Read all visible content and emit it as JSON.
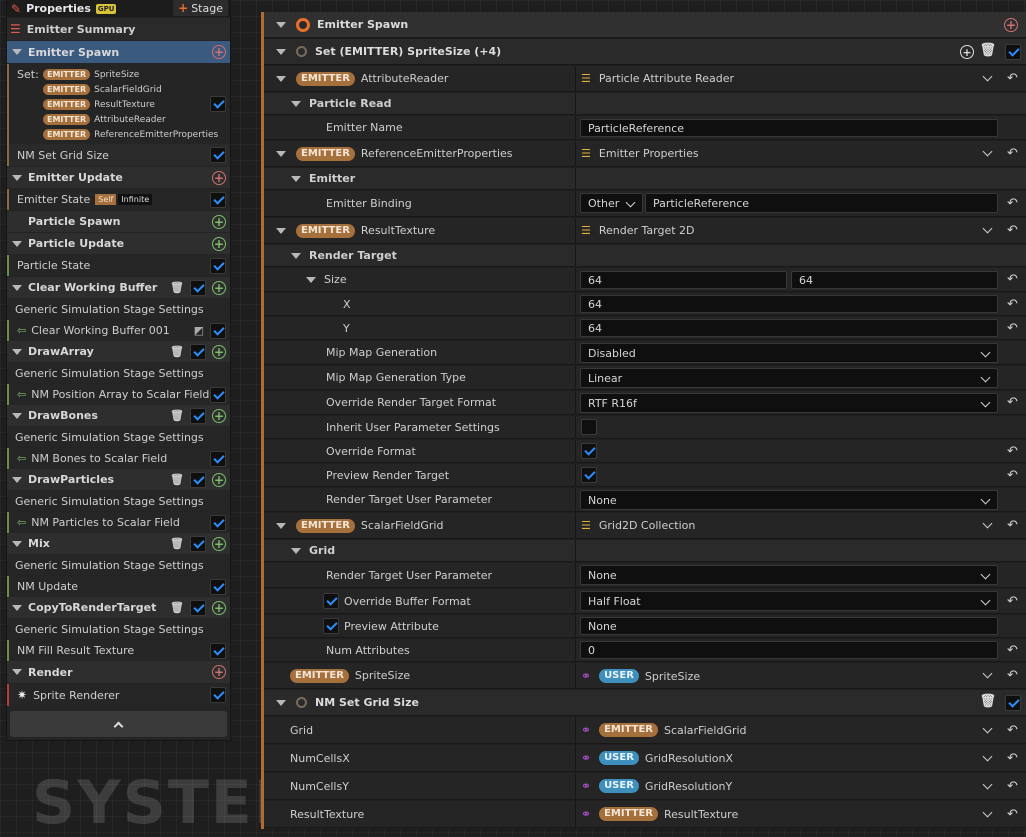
{
  "left": {
    "header": {
      "title": "Properties",
      "gpu_badge": "GPU",
      "stage_button": "Stage"
    },
    "emitter_summary": "Emitter Summary",
    "emitter_spawn": "Emitter Spawn",
    "set_label": "Set:",
    "emitter_badge": "EMITTER",
    "set_items": [
      "SpriteSize",
      "ScalarFieldGrid",
      "ResultTexture",
      "AttributeReader",
      "ReferenceEmitterProperties"
    ],
    "nm_set_grid_size": "NM Set Grid Size",
    "emitter_update": "Emitter Update",
    "emitter_state": "Emitter State",
    "self_badge": "Self",
    "infinite_badge": "Infinite",
    "particle_spawn": "Particle Spawn",
    "particle_update": "Particle Update",
    "particle_state": "Particle State",
    "generic_settings": "Generic Simulation Stage Settings",
    "stages": [
      {
        "title": "Clear Working Buffer",
        "item": "Clear Working Buffer 001"
      },
      {
        "title": "DrawArray",
        "item": "NM Position Array to Scalar Field"
      },
      {
        "title": "DrawBones",
        "item": "NM Bones to Scalar Field"
      },
      {
        "title": "DrawParticles",
        "item": "NM Particles to Scalar Field"
      },
      {
        "title": "Mix",
        "item": "NM Update"
      },
      {
        "title": "CopyToRenderTarget",
        "item": "NM Fill Result Texture"
      }
    ],
    "render": "Render",
    "sprite_renderer": "Sprite Renderer"
  },
  "watermark": "SYSTEM",
  "right": {
    "emitter_spawn": "Emitter Spawn",
    "set_header": "Set (EMITTER) SpriteSize (+4)",
    "emitter_badge": "EMITTER",
    "user_badge": "USER",
    "attribute_reader": {
      "name": "AttributeReader",
      "type": "Particle Attribute Reader",
      "group": "Particle Read",
      "emitter_name_label": "Emitter Name",
      "emitter_name_value": "ParticleReference"
    },
    "reference_props": {
      "name": "ReferenceEmitterProperties",
      "type": "Emitter Properties",
      "group": "Emitter",
      "binding_label": "Emitter Binding",
      "binding_mode": "Other",
      "binding_value": "ParticleReference"
    },
    "result_texture": {
      "name": "ResultTexture",
      "type": "Render Target 2D",
      "group": "Render Target",
      "size_label": "Size",
      "size_x": "64",
      "size_y": "64",
      "x_label": "X",
      "x_value": "64",
      "y_label": "Y",
      "y_value": "64",
      "mip_label": "Mip Map Generation",
      "mip_value": "Disabled",
      "mip_type_label": "Mip Map Generation Type",
      "mip_type_value": "Linear",
      "override_format_label": "Override Render Target Format",
      "override_format_value": "RTF R16f",
      "inherit_label": "Inherit User Parameter Settings",
      "override_label": "Override Format",
      "preview_label": "Preview Render Target",
      "rt_user_param_label": "Render Target User Parameter",
      "rt_user_param_value": "None"
    },
    "scalar_field_grid": {
      "name": "ScalarFieldGrid",
      "type": "Grid2D Collection",
      "group": "Grid",
      "rt_user_param_label": "Render Target User Parameter",
      "rt_user_param_value": "None",
      "buffer_format_label": "Override Buffer Format",
      "buffer_format_value": "Half Float",
      "preview_attr_label": "Preview Attribute",
      "preview_attr_value": "None",
      "num_attr_label": "Num Attributes",
      "num_attr_value": "0"
    },
    "sprite_size": {
      "name": "SpriteSize",
      "value": "SpriteSize"
    },
    "nm_set_grid": {
      "title": "NM Set Grid Size",
      "rows": [
        {
          "label": "Grid",
          "badge": "EMITTER",
          "value": "ScalarFieldGrid"
        },
        {
          "label": "NumCellsX",
          "badge": "USER",
          "value": "GridResolutionX"
        },
        {
          "label": "NumCellsY",
          "badge": "USER",
          "value": "GridResolutionY"
        },
        {
          "label": "ResultTexture",
          "badge": "EMITTER",
          "value": "ResultTexture"
        }
      ]
    }
  },
  "colors": {
    "accent_orange": "#b16c36",
    "emitter_badge": "#a5703c",
    "user_badge": "#3f8fbd",
    "check_blue": "#2d8fff"
  }
}
